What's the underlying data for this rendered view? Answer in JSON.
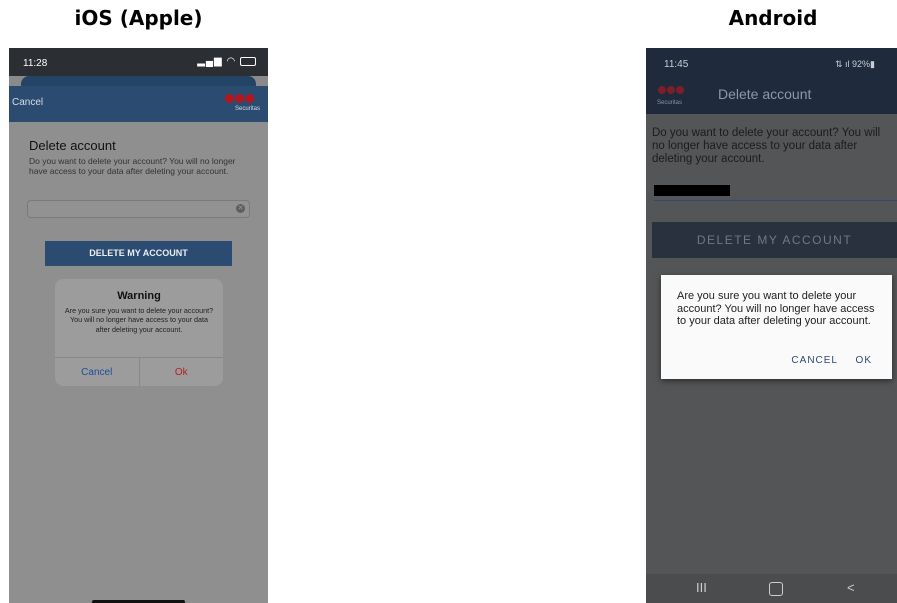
{
  "headings": {
    "ios": "iOS (Apple)",
    "android": "Android"
  },
  "ios": {
    "status_time": "11:28",
    "nav_cancel": "Cancel",
    "logo_text": "Securitas",
    "title": "Delete account",
    "description": "Do you want to delete your account? You will no longer have access to your data after deleting your account.",
    "input_value": "",
    "delete_button": "DELETE MY ACCOUNT",
    "dialog": {
      "title": "Warning",
      "message": "Are you sure you want to delete your account? You will no longer have access to your data after deleting your account.",
      "cancel": "Cancel",
      "ok": "Ok"
    }
  },
  "android": {
    "status_time": "11:45",
    "status_battery": "92%",
    "logo_text": "Securitas",
    "app_title": "Delete account",
    "description": "Do you want to delete your account? You will no longer have access to your data after deleting your account.",
    "delete_button": "DELETE MY ACCOUNT",
    "dialog": {
      "message": "Are you sure you want to delete your account? You will no longer have access to your data after deleting your account.",
      "cancel": "CANCEL",
      "ok": "OK"
    }
  },
  "colors": {
    "securitas_red": "#b5161e",
    "brand_navy": "#2c4b70"
  }
}
